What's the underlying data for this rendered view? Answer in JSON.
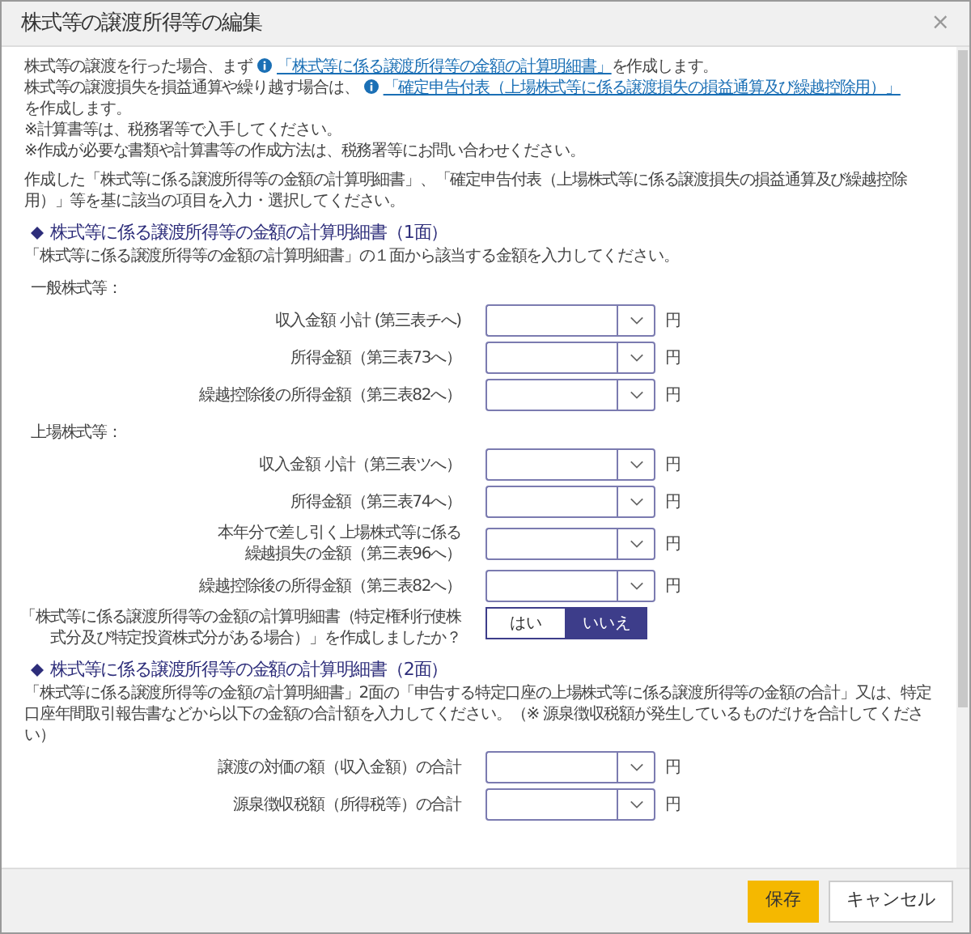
{
  "window": {
    "title": "株式等の譲渡所得等の編集",
    "close": "×"
  },
  "intro": [
    {
      "kind": "link",
      "before": "株式等の譲渡を行った場合、まず",
      "link": "「株式等に係る譲渡所得等の金額の計算明細書」",
      "after": "を作成します。"
    },
    {
      "kind": "link",
      "before": "株式等の譲渡損失を損益通算や繰り越す場合は、",
      "link": "「確定申告付表（上場株式等に係る譲渡損失の損益通算及び繰越控除用）」",
      "after": "を作成します。"
    },
    {
      "kind": "plain",
      "text": "※計算書等は、税務署等で入手してください。"
    },
    {
      "kind": "plain",
      "text": "※作成が必要な書類や計算書等の作成方法は、税務署等にお問い合わせください。"
    }
  ],
  "instruction": "作成した「株式等に係る譲渡所得等の金額の計算明細書」、「確定申告付表（上場株式等に係る譲渡損失の損益通算及び繰越控除用）」等を基に該当の項目を入力・選択してください。",
  "blocks": [
    {
      "kind": "heading",
      "text": "株式等に係る譲渡所得等の金額の計算明細書（1面）"
    },
    {
      "kind": "note",
      "text": "「株式等に係る譲渡所得等の金額の計算明細書」の１面から該当する金額を入力してください。"
    },
    {
      "kind": "group",
      "text": "一般株式等："
    },
    {
      "kind": "field",
      "label": [
        "収入金額 小計 (第三表チへ)"
      ],
      "unit": "円"
    },
    {
      "kind": "field",
      "label": [
        "所得金額（第三表73へ）"
      ],
      "unit": "円"
    },
    {
      "kind": "field",
      "label": [
        "繰越控除後の所得金額（第三表82へ）"
      ],
      "unit": "円"
    },
    {
      "kind": "group",
      "text": "上場株式等："
    },
    {
      "kind": "field",
      "label": [
        "収入金額 小計（第三表ツへ）"
      ],
      "unit": "円"
    },
    {
      "kind": "field",
      "label": [
        "所得金額（第三表74へ）"
      ],
      "unit": "円"
    },
    {
      "kind": "field",
      "label": [
        "本年分で差し引く上場株式等に係る",
        "繰越損失の金額（第三表96へ）"
      ],
      "unit": "円"
    },
    {
      "kind": "field",
      "label": [
        "繰越控除後の所得金額（第三表82へ）"
      ],
      "unit": "円"
    },
    {
      "kind": "toggle",
      "label": [
        "「株式等に係る譲渡所得等の金額の計算明細書（特定権利行使株",
        "式分及び特定投資株式分がある場合）」を作成しましたか？"
      ],
      "options": [
        {
          "label": "はい",
          "selected": false
        },
        {
          "label": "いいえ",
          "selected": true
        }
      ]
    },
    {
      "kind": "heading",
      "text": "株式等に係る譲渡所得等の金額の計算明細書（2面）"
    },
    {
      "kind": "note",
      "text": "「株式等に係る譲渡所得等の金額の計算明細書」2面の「申告する特定口座の上場株式等に係る譲渡所得等の金額の合計」又は、特定口座年間取引報告書などから以下の金額の合計額を入力してください。（※ 源泉徴収税額が発生しているものだけを合計してください）"
    },
    {
      "kind": "field",
      "label": [
        "譲渡の対価の額（収入金額）の合計"
      ],
      "unit": "円"
    },
    {
      "kind": "field",
      "label": [
        "源泉徴収税額（所得税等）の合計"
      ],
      "unit": "円"
    }
  ],
  "buttons": [
    {
      "label": "保存",
      "kind": "primary"
    },
    {
      "label": "キャンセル",
      "kind": "secondary"
    }
  ]
}
